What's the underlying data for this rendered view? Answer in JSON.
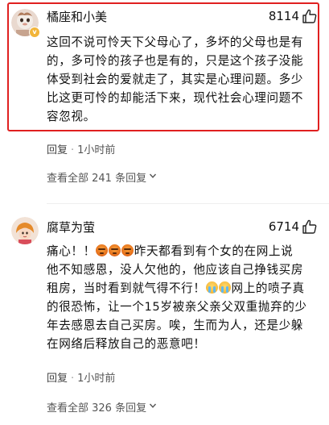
{
  "comments": [
    {
      "username": "橘座和小美",
      "likes": "8114",
      "badge": "v",
      "lines": [
        "这回不说可怜天下父母心了，多坏的父母也是有",
        "的，多可怜的孩子也是有的，只是这个孩子没能",
        "体受到社会的爱就走了，其实是心理问题。多少",
        "比这更可怜的却能活下来，现代社会心理问题不",
        "容忽视。"
      ],
      "reply_label": "回复",
      "separator": "·",
      "time": "1小时前",
      "view_replies": "查看全部 241 条回复"
    },
    {
      "username": "腐草为萤",
      "likes": "6714",
      "line1_prefix": "痛心！！",
      "line1_suffix": "昨天都看到有个女的在网上说",
      "lines_mid": [
        "他不知感恩，没人欠他的，他应该自己挣钱买房"
      ],
      "line3_prefix": "租房，当时看到就气得不行！",
      "line3_suffix": "网上的喷子真",
      "lines_end": [
        "的很恐怖，让一个15岁被亲父亲父双重抛弃的少",
        "年去感恩去自己买房。唉，生而为人，还是少躲",
        "在网络后释放自己的恶意吧！"
      ],
      "reply_label": "回复",
      "separator": "·",
      "time": "1小时前",
      "view_replies": "查看全部 326 条回复"
    }
  ],
  "icons": {
    "like": "thumbs-up-icon",
    "chevron": "chevron-down-icon",
    "angry_emoji": "angry-face-emoji",
    "cry_emoji": "crying-face-emoji"
  },
  "colors": {
    "highlight_border": "#e02020",
    "text": "#111111",
    "meta_text": "#555555"
  }
}
